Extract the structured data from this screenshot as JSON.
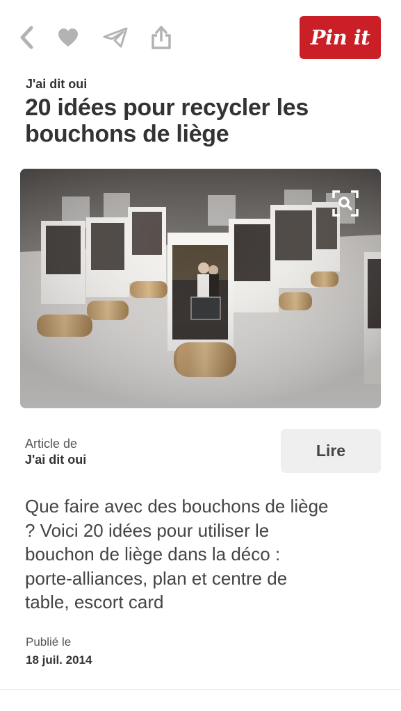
{
  "toolbar": {
    "icons": [
      "back-icon",
      "heart-icon",
      "send-icon",
      "share-icon"
    ],
    "pin_label": "Pin it",
    "pin_color": "#cb1f27",
    "icon_color": "#b3b3b3"
  },
  "pin": {
    "source": "J'ai dit oui",
    "title": "20 idées pour recycler les bouchons de liège",
    "image": {
      "description_icon": "visual-search-icon"
    }
  },
  "article": {
    "label": "Article de",
    "source": "J'ai dit oui",
    "read_label": "Lire"
  },
  "description": "Que faire avec des bouchons de liège ? Voici 20 idées pour utiliser le bouchon de liège dans la déco : porte-alliances, plan et centre de table, escort card",
  "published": {
    "label": "Publié le",
    "date": "18 juil. 2014"
  }
}
